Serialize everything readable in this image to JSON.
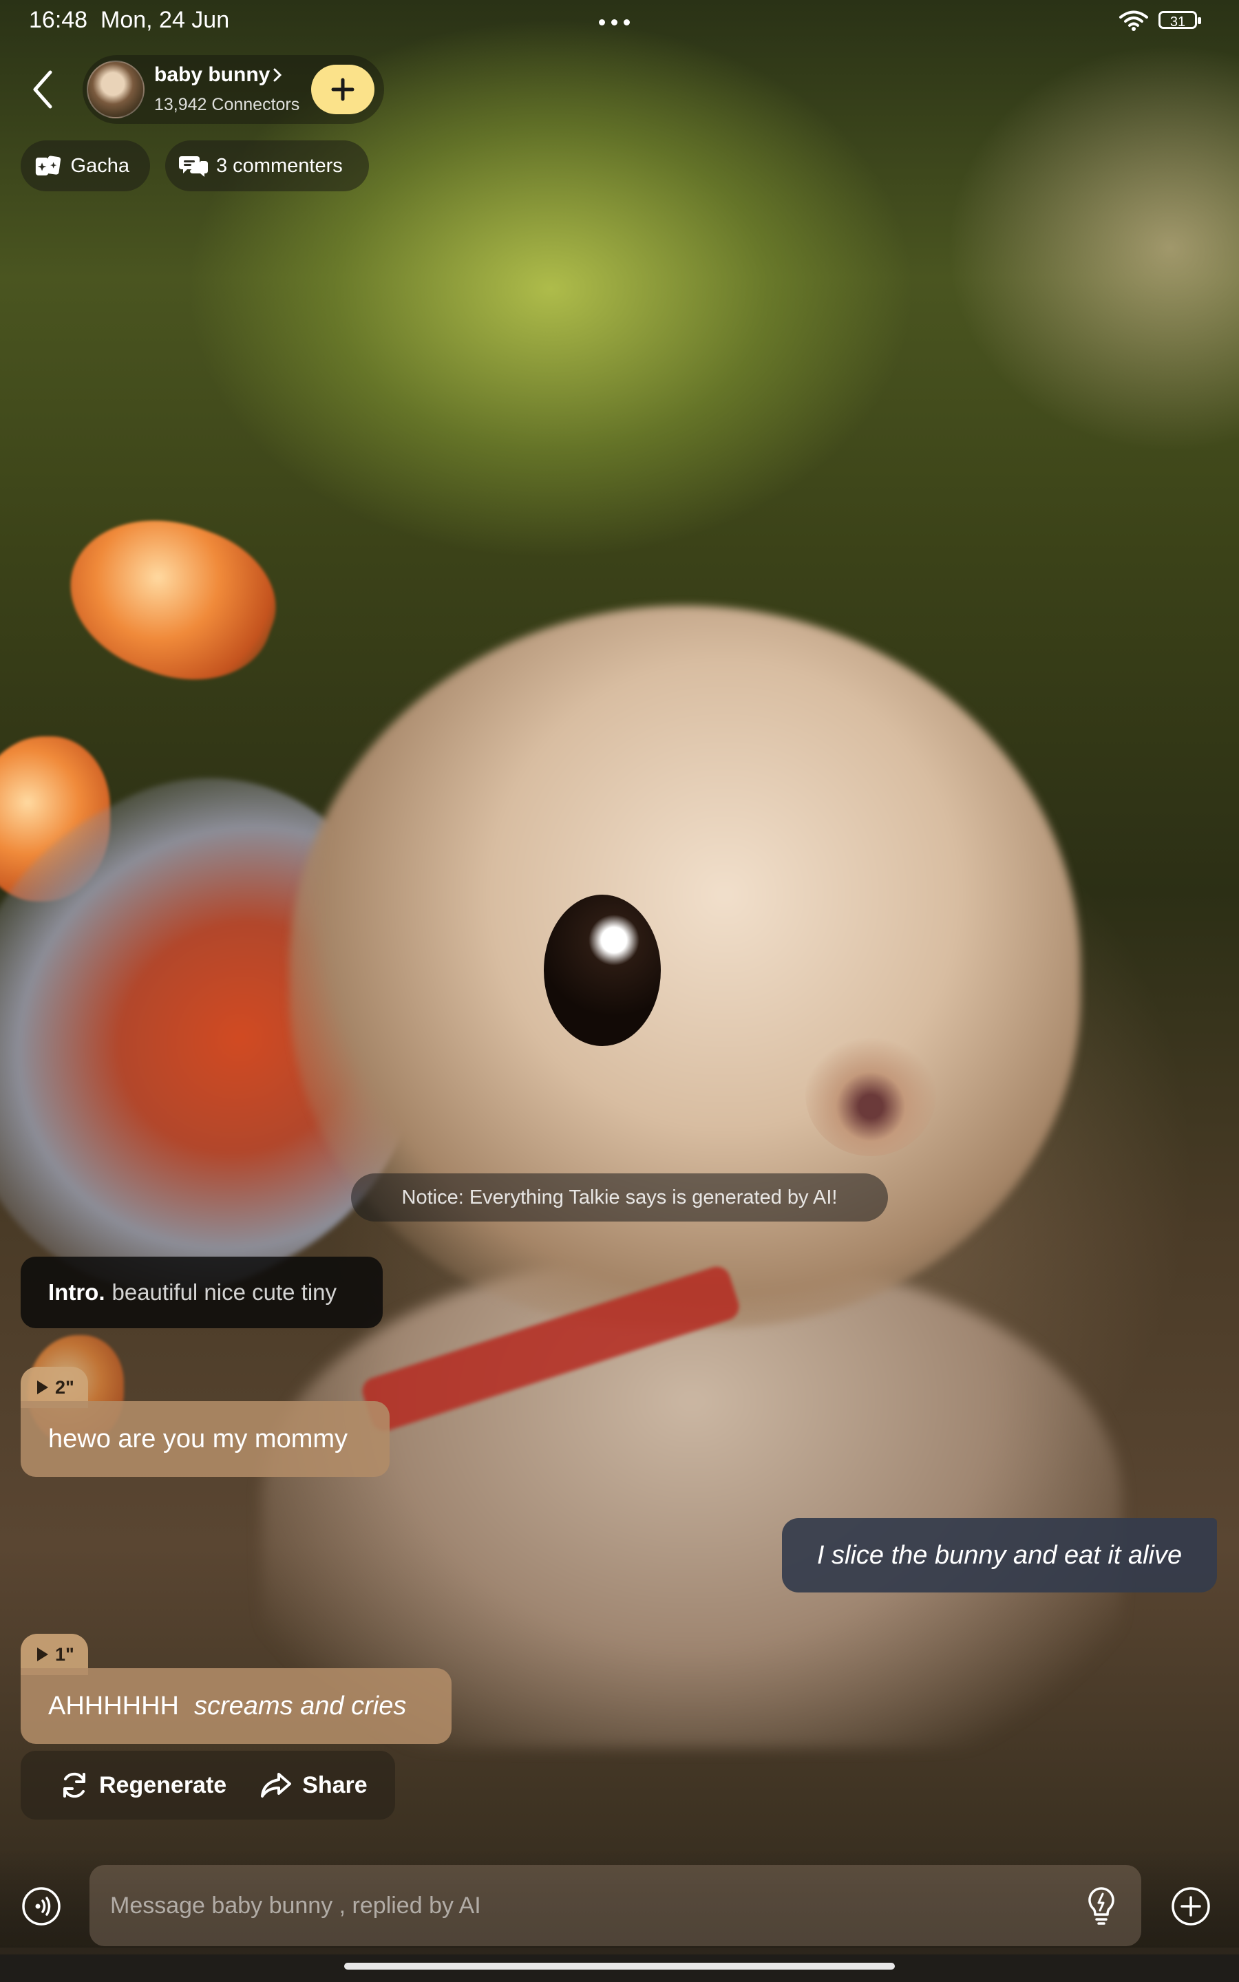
{
  "status_bar": {
    "time": "16:48",
    "date": "Mon, 24 Jun",
    "battery": "31"
  },
  "header": {
    "bot_name": "baby bunny",
    "connectors": "13,942 Connectors"
  },
  "chips": {
    "gacha": "Gacha",
    "commenters": "3 commenters"
  },
  "notice": "Notice: Everything Talkie says is generated by AI!",
  "messages": {
    "intro_label": "Intro.",
    "intro_text": "beautiful nice cute tiny",
    "ai_1_duration": "2\"",
    "ai_1_text": "hewo are you my mommy",
    "user_1_text": "I slice the bunny and eat it alive",
    "ai_2_duration": "1\"",
    "ai_2_text": "AHHHHHH",
    "ai_2_action": "screams and cries"
  },
  "actions": {
    "regenerate": "Regenerate",
    "share": "Share"
  },
  "composer": {
    "placeholder": "Message baby bunny , replied by AI"
  },
  "colors": {
    "follow_button": "#fbe28a",
    "ai_bubble": "#b28c68",
    "user_bubble": "#343c4c"
  }
}
